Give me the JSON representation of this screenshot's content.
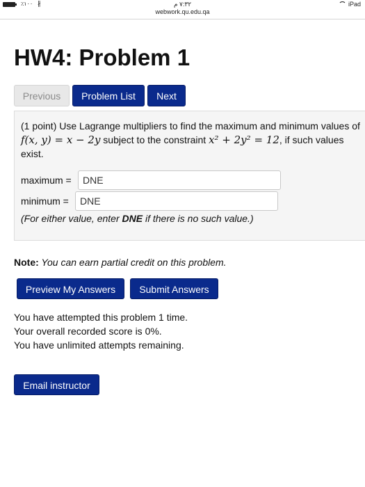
{
  "status_bar": {
    "battery_text": "٪١٠٠",
    "time": "٧:٣٢ م",
    "device": "iPad"
  },
  "url": "webwork.qu.edu.qa",
  "page_title": "HW4: Problem 1",
  "nav": {
    "previous_label": "Previous",
    "problem_list_label": "Problem List",
    "next_label": "Next"
  },
  "problem": {
    "text_intro": "(1 point) Use Lagrange multipliers to find the maximum and minimum values of",
    "func_math": "f(x, y) = x − 2y",
    "text_mid": " subject to the constraint ",
    "constraint_math": "x² + 2y² = 12",
    "text_end": ", if such values exist.",
    "maximum_label": "maximum =",
    "maximum_value": "DNE",
    "minimum_label": "minimum =",
    "minimum_value": "DNE",
    "hint_pre": "(For either value, enter ",
    "hint_bold": "DNE",
    "hint_post": " if there is no such value.)"
  },
  "note": {
    "label": "Note:",
    "text": " You can earn partial credit on this problem."
  },
  "actions": {
    "preview_label": "Preview My Answers",
    "submit_label": "Submit Answers"
  },
  "attempts": {
    "line1": "You have attempted this problem 1 time.",
    "line2": "Your overall recorded score is 0%.",
    "line3": "You have unlimited attempts remaining."
  },
  "email_label": "Email instructor",
  "colors": {
    "button_primary": "#0a2a8c",
    "button_disabled": "#e8e8e8",
    "problem_bg": "#f5f5f5"
  }
}
